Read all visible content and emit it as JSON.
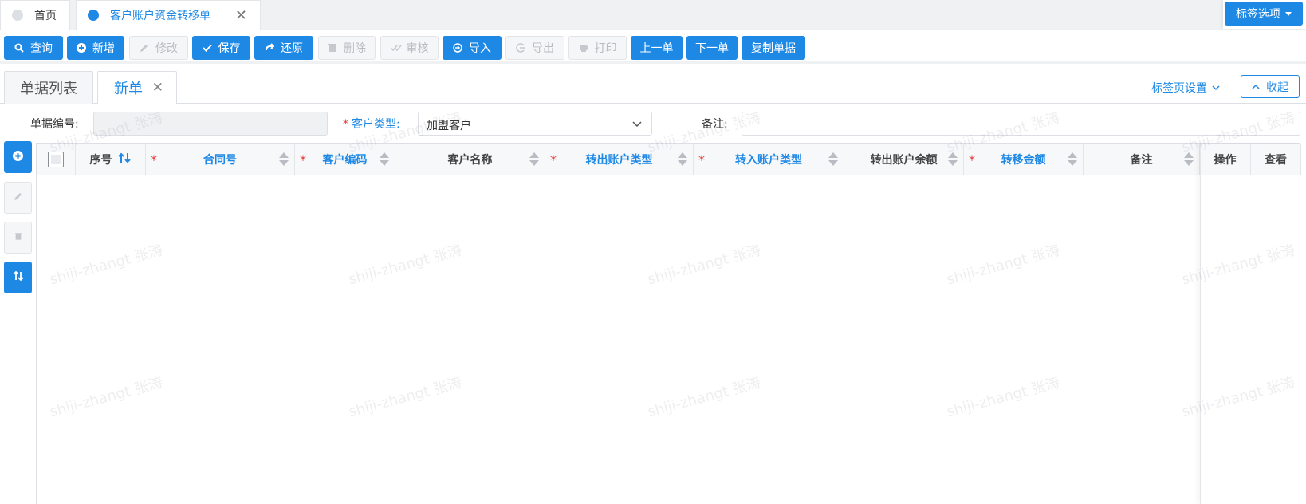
{
  "tabs": {
    "home": "首页",
    "active": "客户账户资金转移单",
    "tag_options": "标签选项"
  },
  "toolbar": {
    "query": "查询",
    "add": "新增",
    "edit": "修改",
    "save": "保存",
    "restore": "还原",
    "delete": "删除",
    "review": "审核",
    "import": "导入",
    "export": "导出",
    "print": "打印",
    "prev": "上一单",
    "next": "下一单",
    "copy": "复制单据"
  },
  "subtabs": {
    "list": "单据列表",
    "new": "新单",
    "tab_settings": "标签页设置",
    "collapse": "收起"
  },
  "form": {
    "doc_no_label": "单据编号:",
    "doc_no_value": "",
    "customer_type_label": "客户类型:",
    "customer_type_value": "加盟客户",
    "remark_label": "备注:",
    "remark_value": ""
  },
  "grid": {
    "columns": {
      "seq": "序号",
      "contract": "合同号",
      "customer_code": "客户编码",
      "customer_name": "客户名称",
      "out_type": "转出账户类型",
      "in_type": "转入账户类型",
      "out_balance": "转出账户余额",
      "amount": "转移金额",
      "remark": "备注",
      "operate": "操作",
      "view": "查看"
    },
    "rows": []
  },
  "watermark": "shiji-zhangt 张涛",
  "colors": {
    "primary": "#1e88e5",
    "required": "#e53935",
    "disabled_text": "#b8bcc2"
  }
}
